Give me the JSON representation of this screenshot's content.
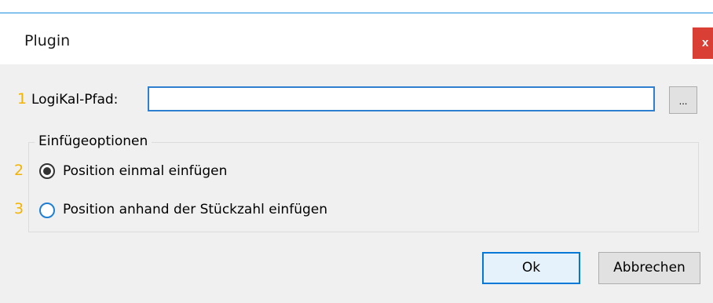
{
  "window": {
    "title": "Plugin",
    "close_glyph": "x",
    "accent_color": "#1a8fdf",
    "close_color": "#d93f35"
  },
  "path_row": {
    "marker": "1",
    "label": "LogiKal-Pfad:",
    "value": "",
    "browse_label": "..."
  },
  "options": {
    "group_title": "Einfügeoptionen",
    "items": [
      {
        "marker": "2",
        "label": "Position einmal einfügen",
        "checked": true
      },
      {
        "marker": "3",
        "label": "Position anhand der Stückzahl einfügen",
        "checked": false
      }
    ]
  },
  "buttons": {
    "ok_label": "Ok",
    "cancel_label": "Abbrechen"
  },
  "marker_color": "#f2b400"
}
